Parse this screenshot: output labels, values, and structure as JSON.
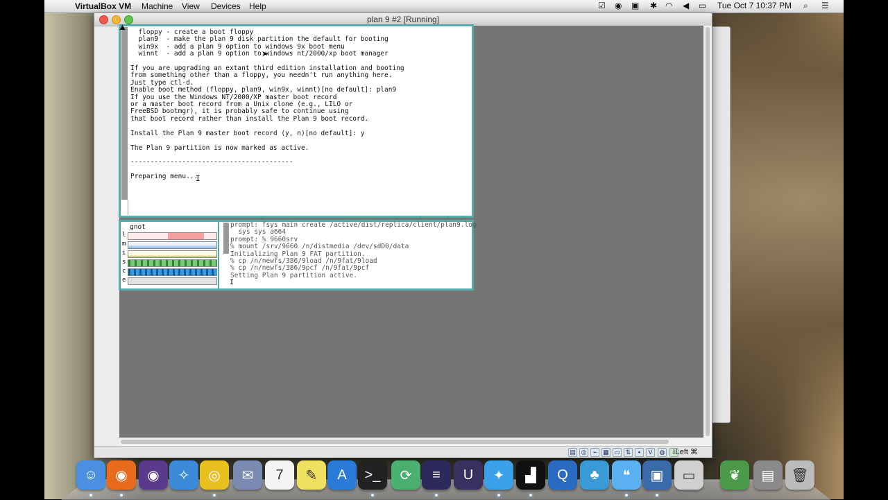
{
  "menubar": {
    "app_name": "VirtualBox VM",
    "items": [
      "Machine",
      "View",
      "Devices",
      "Help"
    ],
    "clock": "Tue Oct 7  10:37 PM"
  },
  "window": {
    "title": "plan 9 #2 [Running]",
    "host_key": "Left ⌘"
  },
  "rio_top": {
    "text": "  floppy - create a boot floppy\n  plan9  - make the plan 9 disk partition the default for booting\n  win9x  - add a plan 9 option to windows 9x boot menu\n  winnt  - add a plan 9 option to windows nt/2000/xp boot manager\n\nIf you are upgrading an extant third edition installation and booting\nfrom something other than a floppy, you needn't run anything here.\nJust type ctl-d.\nEnable boot method (floppy, plan9, win9x, winnt)[no default]: plan9\nIf you use the Windows NT/2000/XP master boot record\nor a master boot record from a Unix clone (e.g., LILO or\nFreeBSD bootmgr), it is probably safe to continue using\nthat boot record rather than install the Plan 9 boot record.\n\nInstall the Plan 9 master boot record (y, n)[no default]: y\n\nThe Plan 9 partition is now marked as active.\n\n-----------------------------------------\n\nPreparing menu..."
  },
  "gnot": {
    "name": "gnot",
    "rows": [
      {
        "label": "l",
        "color": "#f4a0a0"
      },
      {
        "label": "m",
        "color": "#a8c8f0"
      },
      {
        "label": "i",
        "color": "#f8f0b0"
      },
      {
        "label": "s",
        "color": "#7cc87c"
      },
      {
        "label": "c",
        "color": "#3a9ae0"
      },
      {
        "label": "e",
        "color": "#dddddd"
      }
    ]
  },
  "rio_bottom": {
    "text": "prompt: fsys main create /active/dist/replica/client/plan9.log\n  sys sys a664\nprompt: % 9660srv\n% mount /srv/9660 /n/distmedia /dev/sdD0/data\nInitializing Plan 9 FAT partition.\n% cp /n/newfs/386/9load /n/9fat/9load\n% cp /n/newfs/386/9pcf /n/9fat/9pcf\nSetting Plan 9 partition active."
  },
  "dock": {
    "icons": [
      {
        "name": "finder-icon",
        "color": "#4a8fe0",
        "glyph": "☺",
        "running": true
      },
      {
        "name": "firefox-icon",
        "color": "#e86a1c",
        "glyph": "◉",
        "running": true
      },
      {
        "name": "firefox-nightly-icon",
        "color": "#5a3a8a",
        "glyph": "◉",
        "running": false
      },
      {
        "name": "safari-icon",
        "color": "#3a8ad8",
        "glyph": "✧",
        "running": false
      },
      {
        "name": "chrome-icon",
        "color": "#e8c020",
        "glyph": "◎",
        "running": true
      },
      {
        "name": "mail-icon",
        "color": "#7a8ab0",
        "glyph": "✉",
        "running": false
      },
      {
        "name": "calendar-icon",
        "color": "#f4f4f4",
        "glyph": "7",
        "running": false
      },
      {
        "name": "stickies-icon",
        "color": "#f0e060",
        "glyph": "✎",
        "running": false
      },
      {
        "name": "app-store-icon",
        "color": "#2a7ad8",
        "glyph": "A",
        "running": false
      },
      {
        "name": "terminal-icon",
        "color": "#222222",
        "glyph": ">_",
        "running": true
      },
      {
        "name": "network-icon",
        "color": "#4ab070",
        "glyph": "⟳",
        "running": false
      },
      {
        "name": "eclipse-icon",
        "color": "#2c2a5a",
        "glyph": "≡",
        "running": true
      },
      {
        "name": "unreal-icon",
        "color": "#3a3060",
        "glyph": "U",
        "running": false
      },
      {
        "name": "twitter-icon",
        "color": "#3aa0e8",
        "glyph": "✦",
        "running": true
      },
      {
        "name": "activity-monitor-icon",
        "color": "#111111",
        "glyph": "▟",
        "running": true
      },
      {
        "name": "quicktime-icon",
        "color": "#2a6ac0",
        "glyph": "Q",
        "running": false
      },
      {
        "name": "people-icon",
        "color": "#3a9ad8",
        "glyph": "♣",
        "running": false
      },
      {
        "name": "messages-icon",
        "color": "#5ab0f0",
        "glyph": "❝",
        "running": true
      },
      {
        "name": "virtualbox-icon",
        "color": "#3a6aa8",
        "glyph": "▣",
        "running": true
      },
      {
        "name": "vm-window-icon",
        "color": "#d0d0d0",
        "glyph": "▭",
        "running": false
      },
      {
        "name": "evernote-icon",
        "color": "#4a9a4a",
        "glyph": "❦",
        "running": false
      },
      {
        "name": "documents-folder-icon",
        "color": "#8a8a8a",
        "glyph": "▤",
        "running": false
      },
      {
        "name": "trash-icon",
        "color": "#bcbcbc",
        "glyph": "🗑",
        "running": false
      }
    ]
  }
}
